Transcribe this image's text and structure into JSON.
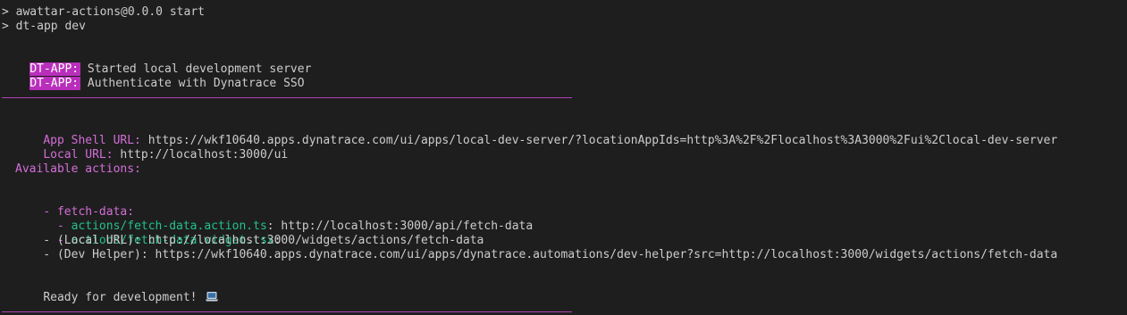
{
  "terminal": {
    "cmd_line_1": "> awattar-actions@0.0.0 start",
    "cmd_line_2": "> dt-app dev",
    "log": [
      {
        "badge": "DT-APP:",
        "text": " Started local development server"
      },
      {
        "badge": "DT-APP:",
        "text": " Authenticate with Dynatrace SSO"
      }
    ],
    "app_shell": {
      "label": "App Shell URL:",
      "value": " https://wkf10640.apps.dynatrace.com/ui/apps/local-dev-server/?locationAppIds=http%3A%2F%2Flocalhost%3A3000%2Fui%2Clocal-dev-server"
    },
    "local_url": {
      "label": "Local URL:",
      "value": " http://localhost:3000/ui"
    },
    "available_actions_label": "Available actions:",
    "actions": {
      "group_prefix": "- ",
      "group_name": "fetch-data:",
      "action_file": {
        "prefix": "  - ",
        "name": "actions/fetch-data.action.ts",
        "value": ": http://localhost:3000/api/fetch-data"
      },
      "widget_file": {
        "prefix": "  - ",
        "name": "actions/fetch-data.widget.tsx",
        "suffix": ":"
      },
      "widget_local": "    - (Local URL): http://localhost:3000/widgets/actions/fetch-data",
      "widget_dev_helper": "    - (Dev Helper): https://wkf10640.apps.dynatrace.com/ui/apps/dynatrace.automations/dev-helper?src=http://localhost:3000/widgets/actions/fetch-data"
    },
    "ready_text": "Ready for development!",
    "ready_icon": "laptop-icon"
  },
  "colors": {
    "background": "#1e1e1e",
    "text": "#cccccc",
    "magenta": "#d36ed8",
    "green": "#23c18a",
    "badge_bg": "#b92fbb",
    "rule": "#b042b3"
  }
}
